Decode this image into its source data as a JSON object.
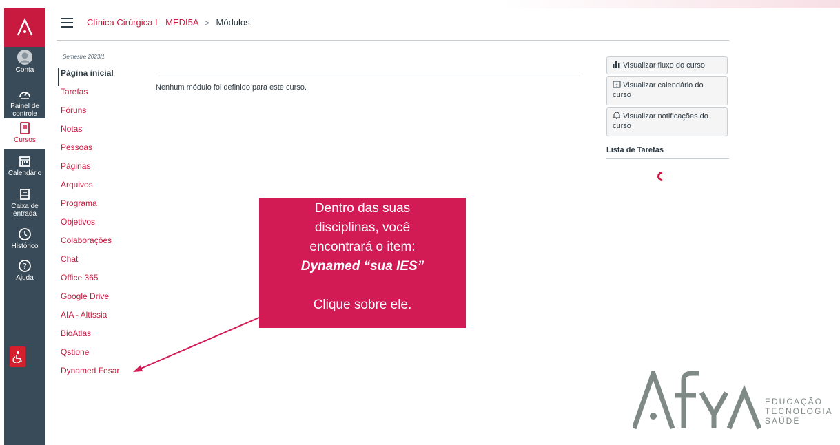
{
  "global_nav": {
    "items": [
      {
        "label": "Conta",
        "icon": "account-icon"
      },
      {
        "label": "Painel de controle",
        "icon": "dashboard-icon"
      },
      {
        "label": "Cursos",
        "icon": "courses-icon",
        "active": true
      },
      {
        "label": "Calendário",
        "icon": "calendar-icon"
      },
      {
        "label": "Caixa de entrada",
        "icon": "inbox-icon"
      },
      {
        "label": "Histórico",
        "icon": "history-icon"
      },
      {
        "label": "Ajuda",
        "icon": "help-icon"
      }
    ]
  },
  "header": {
    "course": "Clínica Cirúrgica I - MEDI5A",
    "separator": ">",
    "current": "Módulos"
  },
  "course_nav": {
    "semester": "Semestre 2023/1",
    "items": [
      {
        "label": "Página inicial",
        "active": true
      },
      {
        "label": "Tarefas"
      },
      {
        "label": "Fóruns"
      },
      {
        "label": "Notas"
      },
      {
        "label": "Pessoas"
      },
      {
        "label": "Páginas"
      },
      {
        "label": "Arquivos"
      },
      {
        "label": "Programa"
      },
      {
        "label": "Objetivos"
      },
      {
        "label": "Colaborações"
      },
      {
        "label": "Chat"
      },
      {
        "label": "Office 365"
      },
      {
        "label": "Google Drive"
      },
      {
        "label": "AIA - Altíssia"
      },
      {
        "label": "BioAtlas"
      },
      {
        "label": "Qstione"
      },
      {
        "label": "Dynamed Fesar"
      }
    ]
  },
  "main": {
    "empty_message": "Nenhum módulo foi definido para este curso."
  },
  "sidebar": {
    "buttons": [
      {
        "label": "Visualizar fluxo do curso",
        "icon": "bar-chart-icon"
      },
      {
        "label": "Visualizar calendário do curso",
        "icon": "calendar-icon"
      },
      {
        "label": "Visualizar notificações do curso",
        "icon": "bell-icon"
      }
    ],
    "todo_title": "Lista de Tarefas"
  },
  "callout": {
    "line1": "Dentro das suas",
    "line2": "disciplinas, você",
    "line3": "encontrará o item:",
    "line4": "Dynamed “sua IES”",
    "line5": "Clique sobre ele."
  },
  "brand": {
    "lines": [
      "EDUCAÇÃO",
      "TECNOLOGIA",
      "SAÚDE"
    ]
  },
  "colors": {
    "accent": "#c8193f",
    "nav_bg": "#394b58",
    "callout_bg": "#d21a55"
  }
}
